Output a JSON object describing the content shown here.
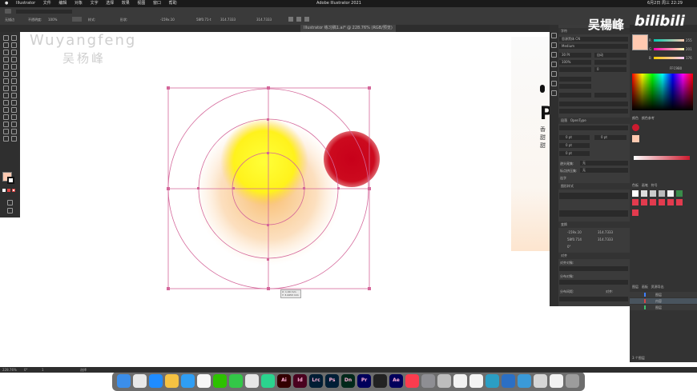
{
  "app": {
    "menus": [
      "Illustrator",
      "文件",
      "编辑",
      "对象",
      "文字",
      "选择",
      "效果",
      "视图",
      "窗口",
      "帮助"
    ],
    "window_title": "Adobe Illustrator 2021",
    "clock": "6月2日 周三 22:29"
  },
  "controlbar": {
    "labels": [
      "无描边",
      "不透明度:",
      "100%",
      "样式:",
      "形状:"
    ],
    "x": "-159x.10",
    "w": "58f0.71-t",
    "y": "314.7333",
    "h": "314.7333"
  },
  "document_tab": {
    "title": "Illustrator 练习稿1.ai* @ 228.76% (RGB/预览)"
  },
  "watermark": {
    "en": "Wuyangfeng",
    "cn": "吴杨峰",
    "top_right": "吴楊峰",
    "site": "bilibili"
  },
  "canvas": {
    "side_text_big": "Pl",
    "side_text_small": "香甜甜",
    "tooltip_line1": "X: 1.00 mm",
    "tooltip_line2": "Y: 3.4453 mm",
    "colors": {
      "red_circle": "#cc0a1e",
      "yellow_core": "#fff31a",
      "orange_glow": "#f6b46a",
      "guide": "#d4679a"
    }
  },
  "right_dock": {
    "character_panel": {
      "tab": "字符",
      "font": "思源黑体 CN",
      "style": "Medium",
      "size": "30 Pt",
      "leading": "自动",
      "tracking": "0",
      "scale": "100%"
    },
    "paragraph_panel": {
      "tabs": [
        "段落",
        "OpenType"
      ],
      "indent_values": [
        "0 pt",
        "0 pt",
        "0 pt",
        "0 pt"
      ],
      "composer_label": "避头尾集:",
      "composer_value": "无",
      "mojikumi_label": "标点挤压集:",
      "mojikumi_value": "无",
      "hyphenate": "连字"
    },
    "graphic_styles": {
      "tab": "图形样式"
    },
    "transform": {
      "tab": "变换",
      "x": "-159x.10",
      "y": "58f0.714",
      "w": "314.7333",
      "h": "314.7333",
      "angle": "0°"
    },
    "align": {
      "tab": "对齐",
      "objects_label": "对齐对象:",
      "distribute_label": "分布对象:",
      "spacing_label": "分布间距:",
      "align_to": "对齐:"
    }
  },
  "color_panel": {
    "tabs": [
      "颜色",
      "颜色参考"
    ],
    "r": "255",
    "g": "201",
    "b": "176",
    "hex": "FFC9B0",
    "swatch_tabs": [
      "色板",
      "画笔",
      "符号"
    ],
    "stroke_label": "描边",
    "gradient_label": "渐变",
    "fill_color": "#cc1a2e"
  },
  "layers": {
    "tabs": [
      "图层",
      "画板",
      "资源导出"
    ],
    "rows": [
      {
        "name": "图层",
        "color": "#3f7fff"
      },
      {
        "name": "内容",
        "color": "#d64646"
      },
      {
        "name": "图层",
        "color": "#3fbf6b"
      }
    ],
    "footer": "3 个图层"
  },
  "status": {
    "zoom": "228.76%",
    "angle": "0°",
    "page": "1",
    "tool": "选择"
  },
  "dock": {
    "apps": [
      {
        "name": "Finder",
        "color": "#3b8eea"
      },
      {
        "name": "Launchpad",
        "color": "#e8e8e8"
      },
      {
        "name": "Safari",
        "color": "#1f8cff"
      },
      {
        "name": "Chrome",
        "color": "#f5c242"
      },
      {
        "name": "Mail",
        "color": "#2f9ef4"
      },
      {
        "name": "Photos",
        "color": "#f7f7f7"
      },
      {
        "name": "WeChat",
        "color": "#2dc100"
      },
      {
        "name": "Messages",
        "color": "#33c748"
      },
      {
        "name": "Baidu",
        "color": "#e6e6e6"
      },
      {
        "name": "Feishu",
        "color": "#2bd38e"
      },
      {
        "name": "Illustrator",
        "color": "#330000",
        "label": "Ai"
      },
      {
        "name": "InDesign",
        "color": "#49021f",
        "label": "Id"
      },
      {
        "name": "Lightroom",
        "color": "#001d34",
        "label": "Lrc"
      },
      {
        "name": "Photoshop",
        "color": "#001e36",
        "label": "Ps"
      },
      {
        "name": "Dimension",
        "color": "#00281a",
        "label": "Dn"
      },
      {
        "name": "Premiere",
        "color": "#00005b",
        "label": "Pr"
      },
      {
        "name": "Finalcut",
        "color": "#222222"
      },
      {
        "name": "AfterEffects",
        "color": "#00005b",
        "label": "Ae"
      },
      {
        "name": "Music",
        "color": "#fb3c4e"
      },
      {
        "name": "Settings",
        "color": "#8e8e93"
      },
      {
        "name": "Quicktime",
        "color": "#bdbdbd"
      },
      {
        "name": "Preview",
        "color": "#f2f2f2"
      },
      {
        "name": "Notes",
        "color": "#f4f4f4"
      },
      {
        "name": "Motion",
        "color": "#2b9ec4"
      },
      {
        "name": "Cinema",
        "color": "#2b6fc4"
      },
      {
        "name": "Browser",
        "color": "#3a9ad9"
      },
      {
        "name": "Files",
        "color": "#d6d6d6"
      },
      {
        "name": "Downloads",
        "color": "#f2f2f2"
      },
      {
        "name": "Trash",
        "color": "#9c9c9c"
      }
    ]
  }
}
